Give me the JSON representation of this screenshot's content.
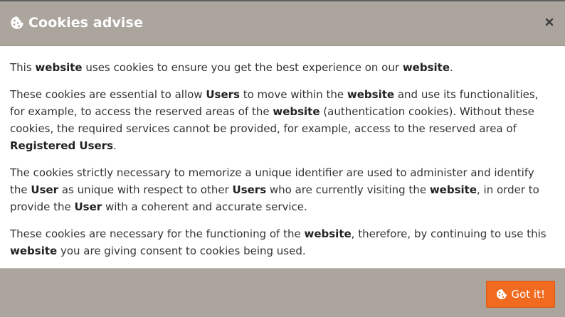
{
  "dialog": {
    "title": "Cookies advise",
    "title_icon": "cookie-icon",
    "close_label": "×",
    "close_icon": "close-icon"
  },
  "paragraphs": [
    [
      {
        "t": "This ",
        "b": false
      },
      {
        "t": "website",
        "b": true
      },
      {
        "t": " uses cookies to ensure you get the best experience on our ",
        "b": false
      },
      {
        "t": "website",
        "b": true
      },
      {
        "t": ".",
        "b": false
      }
    ],
    [
      {
        "t": "These cookies are essential to allow ",
        "b": false
      },
      {
        "t": "Users",
        "b": true
      },
      {
        "t": " to move within the ",
        "b": false
      },
      {
        "t": "website",
        "b": true
      },
      {
        "t": " and use its functionalities, for example, to access the reserved areas of the ",
        "b": false
      },
      {
        "t": "website",
        "b": true
      },
      {
        "t": " (authentication cookies). Without these cookies, the required services cannot be provided, for example, access to the reserved area of ",
        "b": false
      },
      {
        "t": "Registered Users",
        "b": true
      },
      {
        "t": ".",
        "b": false
      }
    ],
    [
      {
        "t": "The cookies strictly necessary to memorize a unique identifier are used to administer and identify the ",
        "b": false
      },
      {
        "t": "User",
        "b": true
      },
      {
        "t": " as unique with respect to other ",
        "b": false
      },
      {
        "t": "Users",
        "b": true
      },
      {
        "t": " who are currently visiting the ",
        "b": false
      },
      {
        "t": "website",
        "b": true
      },
      {
        "t": ", in order to provide the ",
        "b": false
      },
      {
        "t": "User",
        "b": true
      },
      {
        "t": " with a coherent and accurate service.",
        "b": false
      }
    ],
    [
      {
        "t": "These cookies are necessary for the functioning of the ",
        "b": false
      },
      {
        "t": "website",
        "b": true
      },
      {
        "t": ", therefore, by continuing to use this ",
        "b": false
      },
      {
        "t": "website",
        "b": true
      },
      {
        "t": " you are giving consent to cookies being used.",
        "b": false
      }
    ]
  ],
  "footer": {
    "button_label": "Got it!",
    "button_icon": "cookie-icon"
  },
  "colors": {
    "header_bg": "#aca59e",
    "button_bg": "#f06a20",
    "text": "#333333"
  }
}
